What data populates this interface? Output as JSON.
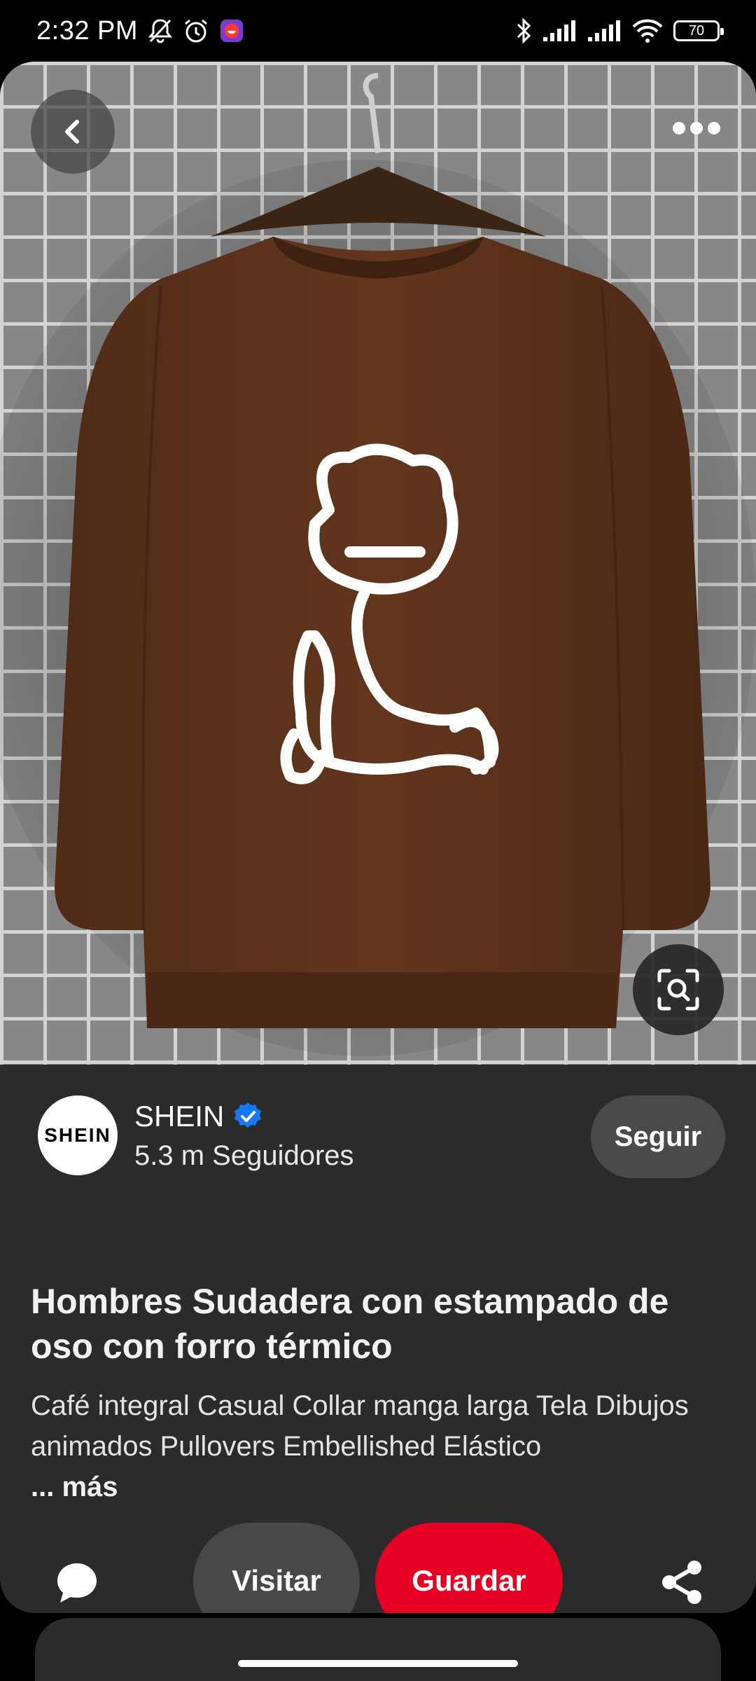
{
  "status_bar": {
    "time": "2:32 PM",
    "battery": "70",
    "icons": [
      "mute-bell-icon",
      "alarm-icon",
      "app-notification-icon",
      "bluetooth-icon",
      "signal-icon",
      "signal-icon",
      "wifi-icon",
      "battery-icon"
    ]
  },
  "pin": {
    "image_alt": "Brown sweatshirt with white dripping teddy bear print on hanger",
    "creator": {
      "avatar_text": "SHEIN",
      "name": "SHEIN",
      "verified": true,
      "followers": "5.3 m Seguidores",
      "follow_label": "Seguir"
    },
    "title": "Hombres Sudadera con estampado de oso con forro térmico",
    "description": "Café integral Casual Collar manga larga Tela Dibujos animados Pullovers Embellished Elástico",
    "more_label": "... más"
  },
  "actions": {
    "visit_label": "Visitar",
    "save_label": "Guardar"
  },
  "colors": {
    "background": "#000000",
    "card": "#2b2b2b",
    "save_red": "#e60023",
    "secondary_button": "#484848",
    "verified_blue": "#1877f2"
  }
}
